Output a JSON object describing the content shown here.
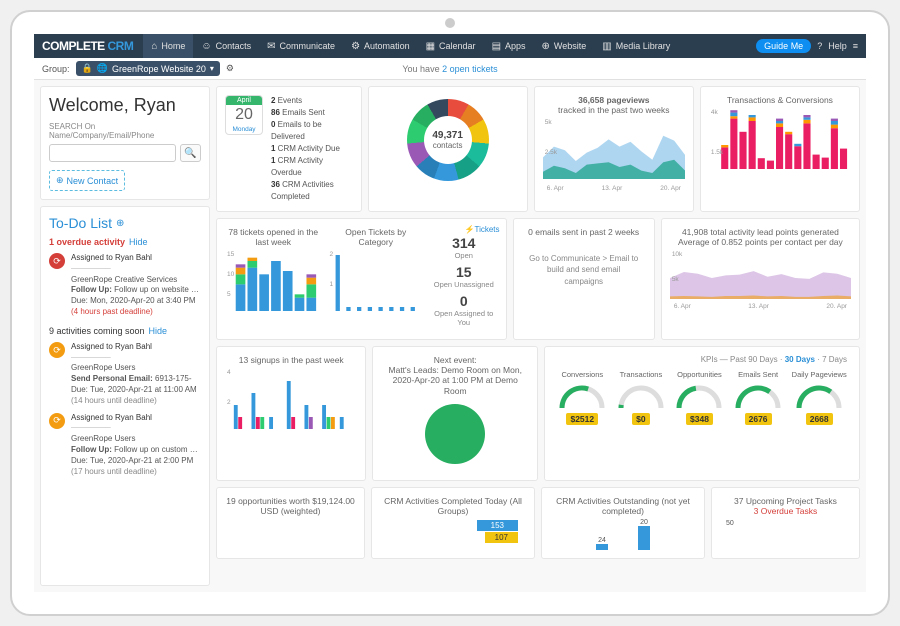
{
  "brand": {
    "p1": "COMPLETE",
    "p2": " CRM"
  },
  "nav": [
    {
      "icon": "⌂",
      "label": "Home"
    },
    {
      "icon": "☺",
      "label": "Contacts"
    },
    {
      "icon": "✉",
      "label": "Communicate"
    },
    {
      "icon": "⚙",
      "label": "Automation"
    },
    {
      "icon": "▦",
      "label": "Calendar"
    },
    {
      "icon": "▤",
      "label": "Apps"
    },
    {
      "icon": "⊕",
      "label": "Website"
    },
    {
      "icon": "▥",
      "label": "Media Library"
    }
  ],
  "topbar": {
    "guide": "Guide Me",
    "help": "Help"
  },
  "groupbar": {
    "label": "Group:",
    "selected": "GreenRope Website 20",
    "msg_pre": "You have ",
    "msg_link": "2 open tickets"
  },
  "welcome": {
    "title": "Welcome, Ryan",
    "search_label": "SEARCH  On Name/Company/Email/Phone",
    "new_contact": "New Contact"
  },
  "calendar": {
    "month": "April",
    "day": "20",
    "weekday": "Monday"
  },
  "stats": [
    {
      "n": "2",
      "t": "Events"
    },
    {
      "n": "86",
      "t": "Emails Sent"
    },
    {
      "n": "0",
      "t": "Emails to be Delivered"
    },
    {
      "n": "1",
      "t": "CRM Activity Due"
    },
    {
      "n": "1",
      "t": "CRM Activity Overdue"
    },
    {
      "n": "36",
      "t": "CRM Activities Completed"
    }
  ],
  "donut": {
    "center_n": "49,371",
    "center_t": "contacts"
  },
  "pageviews": {
    "title": "36,658 pageviews",
    "sub": "tracked in the past two weeks",
    "ticks": [
      "6. Apr",
      "13. Apr",
      "20. Apr"
    ],
    "ylabels": [
      "5k",
      "2.5k"
    ]
  },
  "transconv": {
    "title": "Transactions & Conversions",
    "ylabels": [
      "4k",
      "1.5k"
    ]
  },
  "tickets": {
    "h1": "78 tickets opened in the last week",
    "h2": "Open Tickets by Category",
    "link": "⚡Tickets",
    "y": [
      "15",
      "10",
      "5"
    ],
    "cat_y": [
      "2",
      "1"
    ],
    "stat1_n": "314",
    "stat1_t": "Open",
    "stat2_n": "15",
    "stat2_t": "Open Unassigned",
    "stat3_n": "0",
    "stat3_t": "Open Assigned to You"
  },
  "emails_sent": {
    "title": "0 emails sent in past 2 weeks",
    "msg": "Go to Communicate > Email to build and send email campaigns"
  },
  "leadpoints": {
    "title": "41,908 total activity lead points generated",
    "sub": "Average of 0.852 points per contact per day",
    "y": [
      "10k",
      "5k"
    ],
    "ticks": [
      "6. Apr",
      "13. Apr",
      "20. Apr"
    ]
  },
  "signups": {
    "title": "13 signups in the past week",
    "y": [
      "4",
      "2"
    ]
  },
  "nextevent": {
    "title": "Next event:",
    "line1": "Matt's Leads: Demo Room on Mon,",
    "line2": "2020-Apr-20 at 1:00 PM at Demo Room"
  },
  "kpis": {
    "head_pre": "KPIs — Past ",
    "d90": "90 Days",
    "d30": "30 Days",
    "d7": "7 Days",
    "items": [
      {
        "label": "Conversions",
        "val": "$2512",
        "pct": 0.6
      },
      {
        "label": "Transactions",
        "val": "$0",
        "pct": 0.05
      },
      {
        "label": "Opportunities",
        "val": "$348",
        "pct": 0.45
      },
      {
        "label": "Emails Sent",
        "val": "2676",
        "pct": 0.7
      },
      {
        "label": "Daily Pageviews",
        "val": "2668",
        "pct": 0.7
      }
    ]
  },
  "opps": {
    "title": "19 opportunities worth $19,124.00 USD (weighted)"
  },
  "activities_done": {
    "title": "CRM Activities Completed Today (All Groups)",
    "v1": "153",
    "v2": "107"
  },
  "activities_out": {
    "title": "CRM Activities Outstanding (not yet completed)",
    "v1": "24",
    "v2": "20"
  },
  "project_tasks": {
    "title": "37 Upcoming Project Tasks",
    "sub": "3 Overdue Tasks",
    "v": "50"
  },
  "todo": {
    "title": "To-Do List",
    "overdue": "1 overdue activity",
    "hide": "Hide",
    "coming": "9 activities coming soon",
    "items": [
      {
        "color": "red",
        "assigned": "Assigned to Ryan Bahl",
        "company": "GreenRope Creative Services",
        "action": "Follow Up: Follow up on website said he needs a few weeks wi...",
        "due": "Due: Mon, 2020-Apr-20 at 3:40 PM",
        "deadline": "(4 hours past deadline)",
        "over": true
      },
      {
        "color": "orange",
        "assigned": "Assigned to Ryan Bahl",
        "company": "GreenRope Users",
        "action": "Send Personal Email: 6913-175-",
        "due": "Due: Tue, 2020-Apr-21 at 11:00 AM",
        "deadline": "(14 hours until deadline)",
        "over": false
      },
      {
        "color": "orange",
        "assigned": "Assigned to Ryan Bahl",
        "company": "GreenRope Users",
        "action": "Follow Up: Follow up on custom email template per premium ac...",
        "due": "Due: Tue, 2020-Apr-21 at 2:00 PM",
        "deadline": "(17 hours until deadline)",
        "over": false
      }
    ]
  },
  "chart_data": {
    "pageviews_area": {
      "type": "area",
      "series": [
        {
          "name": "a",
          "values": [
            1800,
            2700,
            2400,
            1500,
            2200,
            2600,
            3300,
            2700,
            3100,
            2300,
            1600,
            3600,
            3200,
            2000
          ]
        },
        {
          "name": "b",
          "values": [
            600,
            1100,
            900,
            500,
            1200,
            1300,
            1400,
            1000,
            1200,
            700,
            500,
            1400,
            1600,
            700
          ]
        }
      ],
      "ylim": [
        0,
        5000
      ],
      "xlabels": [
        "6. Apr",
        "13. Apr",
        "20. Apr"
      ]
    },
    "trans_conv_bars": {
      "type": "stacked-bar",
      "categories": [
        "1",
        "2",
        "3",
        "4",
        "5",
        "6",
        "7",
        "8",
        "9",
        "10",
        "11",
        "12",
        "13",
        "14"
      ],
      "series": [
        {
          "name": "pink",
          "color": "#e91e63",
          "values": [
            1800,
            4200,
            3100,
            4000,
            900,
            700,
            3500,
            2900,
            1900,
            3800,
            1200,
            950,
            3400,
            1700
          ]
        },
        {
          "name": "orange",
          "color": "#ff9800",
          "values": [
            200,
            200,
            0,
            300,
            0,
            0,
            300,
            200,
            0,
            300,
            0,
            0,
            300,
            0
          ]
        },
        {
          "name": "blue",
          "color": "#3498db",
          "values": [
            0,
            300,
            0,
            200,
            0,
            0,
            200,
            0,
            200,
            200,
            0,
            0,
            300,
            0
          ]
        },
        {
          "name": "purple",
          "color": "#9b59b6",
          "values": [
            0,
            200,
            0,
            0,
            0,
            0,
            200,
            0,
            0,
            200,
            0,
            0,
            200,
            0
          ]
        }
      ],
      "ylim": [
        0,
        5000
      ]
    },
    "tickets_opened": {
      "type": "stacked-bar",
      "categories": [
        "d1",
        "d2",
        "d3",
        "d4",
        "d5",
        "d6",
        "d7"
      ],
      "series": [
        {
          "color": "#3498db",
          "values": [
            8,
            13,
            11,
            15,
            12,
            4,
            4
          ]
        },
        {
          "color": "#2ecc71",
          "values": [
            3,
            2,
            0,
            0,
            0,
            1,
            4
          ]
        },
        {
          "color": "#f39c12",
          "values": [
            2,
            1,
            0,
            0,
            0,
            0,
            2
          ]
        },
        {
          "color": "#9b59b6",
          "values": [
            1,
            0,
            0,
            0,
            0,
            0,
            1
          ]
        }
      ],
      "ylim": [
        0,
        18
      ]
    },
    "tickets_category": {
      "type": "bar",
      "categories": [
        "c1",
        "c2",
        "c3",
        "c4",
        "c5",
        "c6",
        "c7",
        "c8"
      ],
      "values": [
        2.8,
        0.2,
        0.2,
        0.2,
        0.2,
        0.2,
        0.2,
        0.2
      ],
      "ylim": [
        0,
        3
      ]
    },
    "leadpoints_area": {
      "type": "area",
      "series": [
        {
          "name": "purple",
          "color": "#9b59b6",
          "values": [
            4800,
            6200,
            5800,
            4800,
            5400,
            5600,
            6400,
            5100,
            5700,
            4800,
            4600,
            6100,
            5800,
            4800
          ]
        },
        {
          "name": "orange",
          "color": "#f39c12",
          "values": [
            600,
            700,
            600,
            500,
            700,
            700,
            800,
            600,
            700,
            500,
            500,
            700,
            800,
            600
          ]
        }
      ],
      "ylim": [
        0,
        11000
      ]
    },
    "signups_bars": {
      "type": "bar-colored",
      "categories": [
        "d1",
        "d2",
        "d3",
        "d4",
        "d5",
        "d6",
        "d7"
      ],
      "bars": [
        [
          {
            "c": "#3498db",
            "v": 2
          },
          {
            "c": "#e91e63",
            "v": 1
          }
        ],
        [
          {
            "c": "#3498db",
            "v": 3
          },
          {
            "c": "#e91e63",
            "v": 1
          },
          {
            "c": "#2ecc71",
            "v": 1
          }
        ],
        [
          {
            "c": "#3498db",
            "v": 1
          }
        ],
        [
          {
            "c": "#3498db",
            "v": 4
          },
          {
            "c": "#e91e63",
            "v": 1
          }
        ],
        [
          {
            "c": "#3498db",
            "v": 2
          },
          {
            "c": "#9b59b6",
            "v": 1
          }
        ],
        [
          {
            "c": "#3498db",
            "v": 2
          },
          {
            "c": "#2ecc71",
            "v": 1
          },
          {
            "c": "#f39c12",
            "v": 1
          }
        ],
        [
          {
            "c": "#3498db",
            "v": 1
          }
        ]
      ],
      "ylim": [
        0,
        5
      ]
    }
  }
}
